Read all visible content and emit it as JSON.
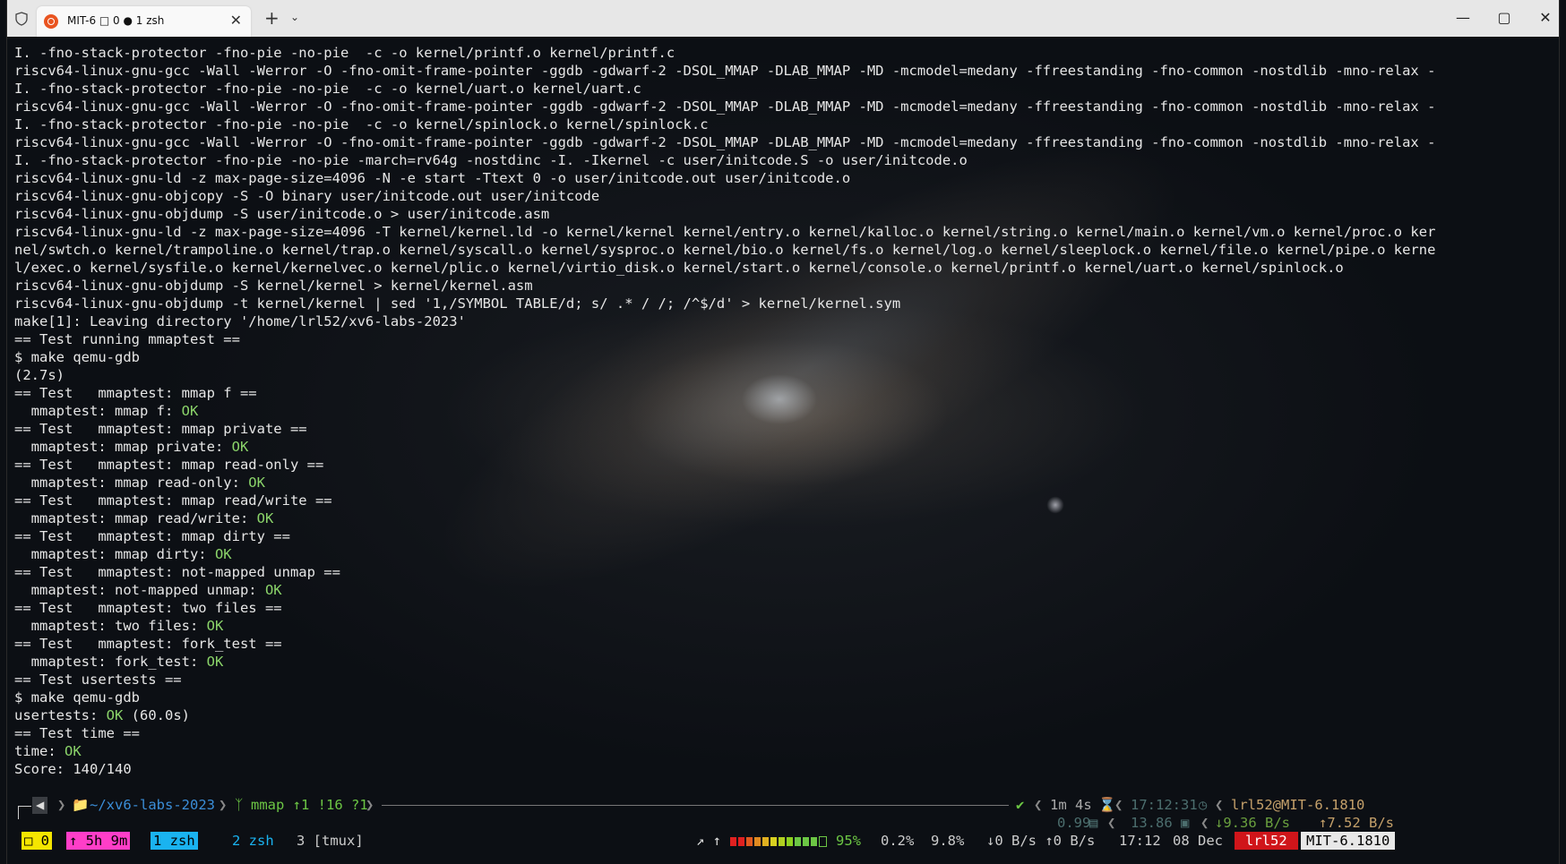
{
  "window": {
    "tab_title": "MIT-6 □ 0 ● 1 zsh",
    "tab_close": "✕",
    "new_tab": "+",
    "tab_dropdown": "⌄",
    "minimize": "—",
    "maximize": "▢",
    "close": "✕"
  },
  "terminal": {
    "lines": [
      {
        "text": "I. -fno-stack-protector -fno-pie -no-pie  -c -o kernel/printf.o kernel/printf.c"
      },
      {
        "text": "riscv64-linux-gnu-gcc -Wall -Werror -O -fno-omit-frame-pointer -ggdb -gdwarf-2 -DSOL_MMAP -DLAB_MMAP -MD -mcmodel=medany -ffreestanding -fno-common -nostdlib -mno-relax -"
      },
      {
        "text": "I. -fno-stack-protector -fno-pie -no-pie  -c -o kernel/uart.o kernel/uart.c"
      },
      {
        "text": "riscv64-linux-gnu-gcc -Wall -Werror -O -fno-omit-frame-pointer -ggdb -gdwarf-2 -DSOL_MMAP -DLAB_MMAP -MD -mcmodel=medany -ffreestanding -fno-common -nostdlib -mno-relax -"
      },
      {
        "text": "I. -fno-stack-protector -fno-pie -no-pie  -c -o kernel/spinlock.o kernel/spinlock.c"
      },
      {
        "text": "riscv64-linux-gnu-gcc -Wall -Werror -O -fno-omit-frame-pointer -ggdb -gdwarf-2 -DSOL_MMAP -DLAB_MMAP -MD -mcmodel=medany -ffreestanding -fno-common -nostdlib -mno-relax -"
      },
      {
        "text": "I. -fno-stack-protector -fno-pie -no-pie -march=rv64g -nostdinc -I. -Ikernel -c user/initcode.S -o user/initcode.o"
      },
      {
        "text": "riscv64-linux-gnu-ld -z max-page-size=4096 -N -e start -Ttext 0 -o user/initcode.out user/initcode.o"
      },
      {
        "text": "riscv64-linux-gnu-objcopy -S -O binary user/initcode.out user/initcode"
      },
      {
        "text": "riscv64-linux-gnu-objdump -S user/initcode.o > user/initcode.asm"
      },
      {
        "text": "riscv64-linux-gnu-ld -z max-page-size=4096 -T kernel/kernel.ld -o kernel/kernel kernel/entry.o kernel/kalloc.o kernel/string.o kernel/main.o kernel/vm.o kernel/proc.o ker"
      },
      {
        "text": "nel/swtch.o kernel/trampoline.o kernel/trap.o kernel/syscall.o kernel/sysproc.o kernel/bio.o kernel/fs.o kernel/log.o kernel/sleeplock.o kernel/file.o kernel/pipe.o kerne"
      },
      {
        "text": "l/exec.o kernel/sysfile.o kernel/kernelvec.o kernel/plic.o kernel/virtio_disk.o kernel/start.o kernel/console.o kernel/printf.o kernel/uart.o kernel/spinlock.o"
      },
      {
        "text": "riscv64-linux-gnu-objdump -S kernel/kernel > kernel/kernel.asm"
      },
      {
        "text": "riscv64-linux-gnu-objdump -t kernel/kernel | sed '1,/SYMBOL TABLE/d; s/ .* / /; /^$/d' > kernel/kernel.sym"
      },
      {
        "text": "make[1]: Leaving directory '/home/lrl52/xv6-labs-2023'"
      },
      {
        "text": "== Test running mmaptest =="
      },
      {
        "text": "$ make qemu-gdb"
      },
      {
        "text": "(2.7s)"
      },
      {
        "text": "== Test   mmaptest: mmap f =="
      },
      {
        "text": "  mmaptest: mmap f: ",
        "ok": "OK"
      },
      {
        "text": "== Test   mmaptest: mmap private =="
      },
      {
        "text": "  mmaptest: mmap private: ",
        "ok": "OK"
      },
      {
        "text": "== Test   mmaptest: mmap read-only =="
      },
      {
        "text": "  mmaptest: mmap read-only: ",
        "ok": "OK"
      },
      {
        "text": "== Test   mmaptest: mmap read/write =="
      },
      {
        "text": "  mmaptest: mmap read/write: ",
        "ok": "OK"
      },
      {
        "text": "== Test   mmaptest: mmap dirty =="
      },
      {
        "text": "  mmaptest: mmap dirty: ",
        "ok": "OK"
      },
      {
        "text": "== Test   mmaptest: not-mapped unmap =="
      },
      {
        "text": "  mmaptest: not-mapped unmap: ",
        "ok": "OK"
      },
      {
        "text": "== Test   mmaptest: two files =="
      },
      {
        "text": "  mmaptest: two files: ",
        "ok": "OK"
      },
      {
        "text": "== Test   mmaptest: fork_test =="
      },
      {
        "text": "  mmaptest: fork_test: ",
        "ok": "OK"
      },
      {
        "text": "== Test usertests =="
      },
      {
        "text": "$ make qemu-gdb"
      },
      {
        "text": "usertests: ",
        "ok": "OK",
        "after": " (60.0s)"
      },
      {
        "text": "== Test time =="
      },
      {
        "text": "time: ",
        "ok": "OK"
      },
      {
        "text": "Score: 140/140"
      }
    ]
  },
  "prompt": {
    "dir": "~/xv6-labs-2023",
    "branch": "mmap ↑1 !16 ?1",
    "status_ok": "✔",
    "duration": "1m 4s",
    "clock": "17:12:31",
    "user_host": "lrl52@MIT-6.1810",
    "load": "0.99",
    "mem": "13.86",
    "net_down": "↓9.36 B/s",
    "net_up": "↑7.52 B/s"
  },
  "tmux": {
    "session": "0",
    "uptime": "↑ 5h 9m",
    "windows": [
      {
        "label": "1 zsh"
      },
      {
        "label": "2 zsh"
      },
      {
        "label": "3 [tmux]"
      }
    ],
    "arrows": "↗ ↑",
    "battery": "95%",
    "battery_level": 0.95,
    "cpu": "0.2%",
    "mem": "9.8%",
    "net": "↓0 B/s ↑0 B/s",
    "time": "17:12",
    "date": "08 Dec",
    "user": "lrl52",
    "host": "MIT-6.1810"
  }
}
